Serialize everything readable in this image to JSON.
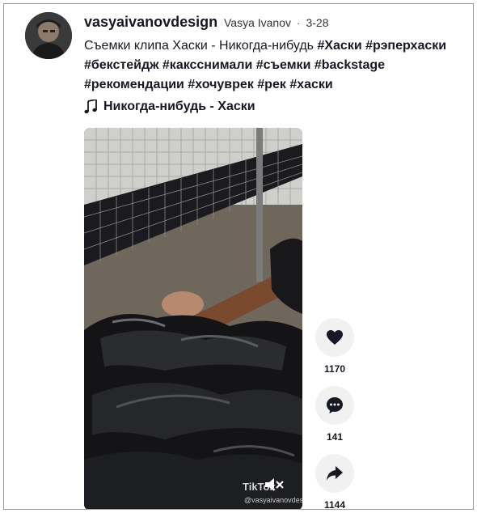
{
  "post": {
    "username": "vasyaivanovdesign",
    "nickname": "Vasya Ivanov",
    "separator": "·",
    "date": "3-28",
    "description_text": "Съемки клипа Хаски - Никогда-нибудь",
    "hashtags": [
      "#Хаски",
      "#рэперхаски",
      "#бекстейдж",
      "#каксснимали",
      "#съемки",
      "#backstage",
      "#рекомендации",
      "#хочуврек",
      "#рек",
      "#хаски"
    ],
    "music_title": "Никогда-нибудь - Хаски"
  },
  "video": {
    "watermark_logo": "TikTok",
    "watermark_handle": "@vasyaivanovdesign"
  },
  "actions": {
    "likes": "1170",
    "comments": "141",
    "shares": "1144"
  },
  "icons": {
    "like": "heart-icon",
    "comment": "comment-icon",
    "share": "share-icon",
    "music": "music-note-icon",
    "mute": "mute-icon"
  },
  "colors": {
    "text": "#161823",
    "button_bg": "#f1f1f2"
  }
}
